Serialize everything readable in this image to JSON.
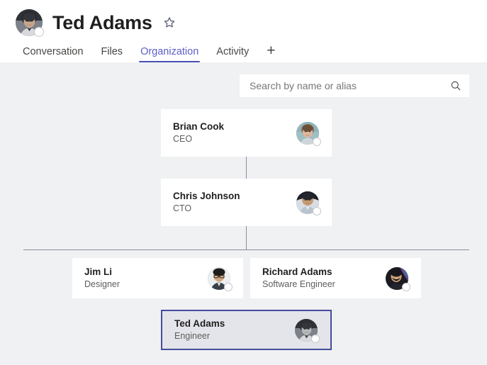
{
  "header": {
    "title": "Ted Adams",
    "avatar_name": "ted-adams-avatar",
    "favorite_icon": "star-outline-icon"
  },
  "tabs": {
    "items": [
      {
        "label": "Conversation",
        "active": false
      },
      {
        "label": "Files",
        "active": false
      },
      {
        "label": "Organization",
        "active": true
      },
      {
        "label": "Activity",
        "active": false
      }
    ],
    "add_label": "+"
  },
  "search": {
    "placeholder": "Search by name or alias",
    "value": "",
    "icon": "search-icon"
  },
  "org_chart": {
    "nodes": [
      {
        "id": "brian-cook",
        "name": "Brian Cook",
        "role": "CEO",
        "selected": false,
        "presence": "offline"
      },
      {
        "id": "chris-johnson",
        "name": "Chris Johnson",
        "role": "CTO",
        "selected": false,
        "presence": "offline"
      },
      {
        "id": "jim-li",
        "name": "Jim Li",
        "role": "Designer",
        "selected": false,
        "presence": "offline"
      },
      {
        "id": "richard-adams",
        "name": "Richard Adams",
        "role": "Software Engineer",
        "selected": false,
        "presence": "offline"
      },
      {
        "id": "ted-adams",
        "name": "Ted Adams",
        "role": "Engineer",
        "selected": true,
        "presence": "offline"
      }
    ]
  },
  "colors": {
    "accent": "#4a51b5",
    "accent_text": "#5b5fc7",
    "selected_border": "#464c9c",
    "selected_bg": "#e4e5ea",
    "page_bg": "#f0f1f3",
    "card_bg": "#ffffff",
    "connector": "#8b8d98"
  }
}
